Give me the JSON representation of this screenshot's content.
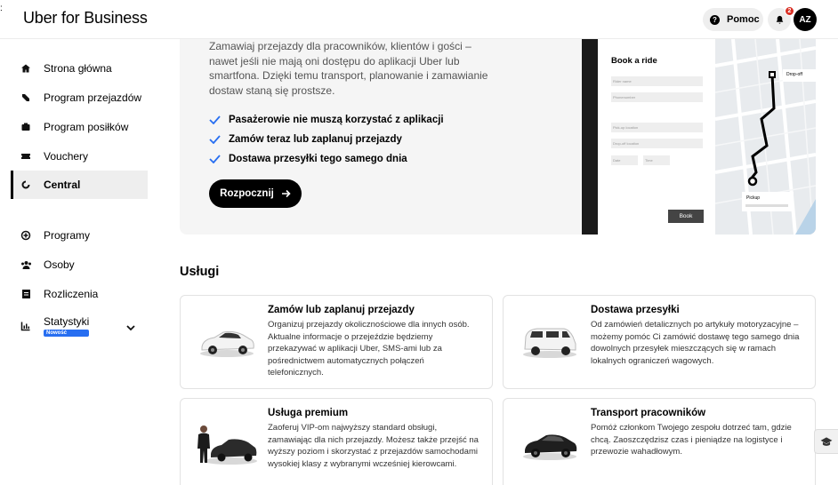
{
  "header": {
    "logo": "Uber for Business",
    "help_label": "Pomoc",
    "notifications_count": "2",
    "avatar_initials": "AZ",
    "edge_mark": ":"
  },
  "sidebar": {
    "items": [
      {
        "label": "Strona główna",
        "icon": "home-icon"
      },
      {
        "label": "Program przejazdów",
        "icon": "rides-icon"
      },
      {
        "label": "Program posiłków",
        "icon": "meals-icon"
      },
      {
        "label": "Vouchery",
        "icon": "voucher-icon"
      },
      {
        "label": "Central",
        "icon": "central-icon",
        "active": true
      },
      {
        "label": "Programy",
        "icon": "programs-icon"
      },
      {
        "label": "Osoby",
        "icon": "people-icon"
      },
      {
        "label": "Rozliczenia",
        "icon": "billing-icon"
      },
      {
        "label": "Statystyki",
        "icon": "stats-icon",
        "badge": "Nowość"
      }
    ]
  },
  "hero": {
    "description": "Zamawiaj przejazdy dla pracowników, klientów i gości – nawet jeśli nie mają oni dostępu do aplikacji Uber lub smartfona. Dzięki temu transport, planowanie i zamawianie dostaw staną się prostsze.",
    "checks": [
      "Pasażerowie nie muszą korzystać z aplikacji",
      "Zamów teraz lub zaplanuj przejazdy",
      "Dostawa przesyłki tego samego dnia"
    ],
    "cta_label": "Rozpocznij"
  },
  "mock": {
    "title": "Book a ride",
    "fields": [
      "Rider name",
      "Phonenumber",
      "Pick-up location",
      "Drop-off location"
    ],
    "date_label": "Date",
    "time_label": "Time",
    "book_label": "Book",
    "dropoff_label": "Drop-off",
    "pickup_label": "Pickup"
  },
  "services": {
    "title": "Usługi",
    "cards": [
      {
        "title": "Zamów lub zaplanuj przejazdy",
        "desc": "Organizuj przejazdy okolicznościowe dla innych osób. Aktualne informacje o przejeździe będziemy przekazywać w aplikacji Uber, SMS-ami lub za pośrednictwem automatycznych połączeń telefonicznych.",
        "image": "white-car"
      },
      {
        "title": "Dostawa przesyłki",
        "desc": "Od zamówień detalicznych po artykuły motoryzacyjne – możemy pomóc Ci zamówić dostawę tego samego dnia dowolnych przesyłek mieszczących się w ramach lokalnych ograniczeń wagowych.",
        "image": "white-van"
      },
      {
        "title": "Usługa premium",
        "desc": "Zaoferuj VIP-om najwyższy standard obsługi, zamawiając dla nich przejazdy. Możesz także przejść na wyższy poziom i skorzystać z przejazdów samochodami wysokiej klasy z wybranymi wcześniej kierowcami.",
        "image": "chauffeur-black-car"
      },
      {
        "title": "Transport pracowników",
        "desc": "Pomóż członkom Twojego zespołu dotrzeć tam, gdzie chcą. Zaoszczędzisz czas i pieniądze na logistyce i przewozie wahadłowym.",
        "image": "black-car"
      }
    ]
  },
  "colors": {
    "accent_blue": "#276ef1",
    "check_blue": "#276ef1",
    "badge_red": "#d93025",
    "hero_bg": "#f5f5f5"
  }
}
